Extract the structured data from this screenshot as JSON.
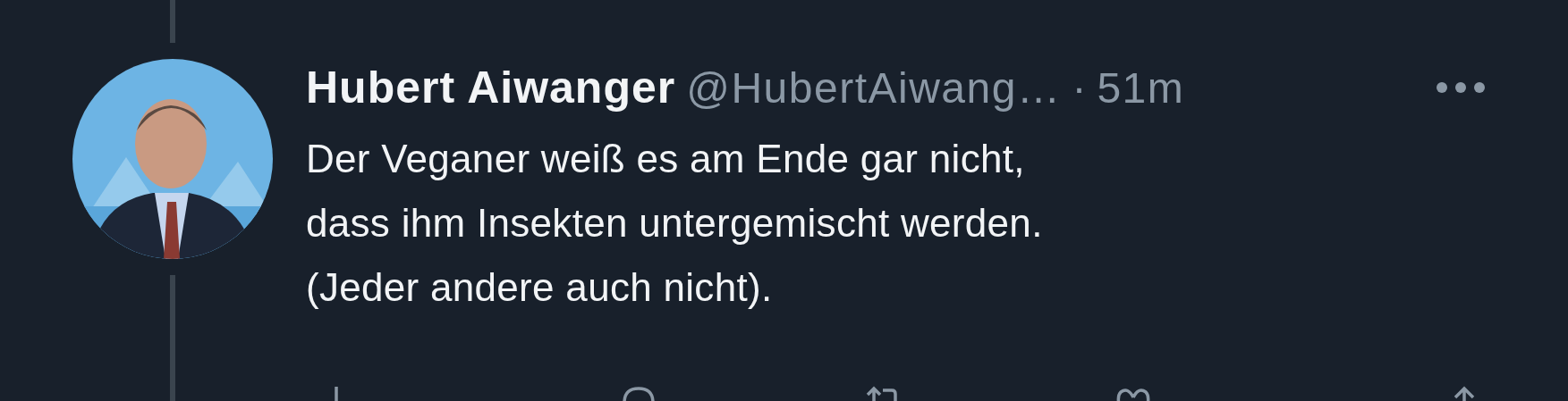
{
  "author": {
    "name": "Hubert Aiwanger",
    "handle": "@HubertAiwang…",
    "separator": "·",
    "time": "51m"
  },
  "body": [
    "Der Veganer weiß es am Ende gar nicht,",
    "dass ihm Insekten untergemischt werden.",
    "(Jeder andere auch nicht)."
  ]
}
